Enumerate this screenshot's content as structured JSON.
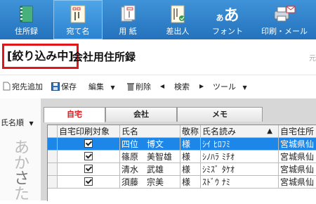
{
  "ribbon": {
    "tabs": [
      {
        "label": "住所録",
        "icon": "address-book-icon",
        "active": false
      },
      {
        "label": "宛て名",
        "icon": "address-card-icon",
        "active": true
      },
      {
        "label": "用 紙",
        "icon": "paper-icon",
        "active": false
      },
      {
        "label": "差出人",
        "icon": "sender-icon",
        "active": false
      },
      {
        "label": "フォント",
        "icon": "font-icon",
        "active": false
      },
      {
        "label": "印刷・メール",
        "icon": "printer-mail-icon",
        "active": false
      }
    ],
    "font_glyph_small": "あ",
    "font_glyph_large": "あ"
  },
  "header": {
    "filter_badge": "[絞り込み中]",
    "title": "会社用住所録",
    "right_fragment": "元"
  },
  "toolbar": {
    "add_address": "宛先追加",
    "save": "保存",
    "edit": "編集",
    "delete": "削除",
    "search": "検索",
    "tools": "ツール"
  },
  "left_panel": {
    "sort_label": "氏名順",
    "kana": [
      "あ",
      "か",
      "さ",
      "た"
    ]
  },
  "tabs": [
    {
      "label": "自宅",
      "active": true
    },
    {
      "label": "会社",
      "active": false
    },
    {
      "label": "メモ",
      "active": false
    }
  ],
  "table": {
    "columns": [
      "自宅印刷対象",
      "氏名",
      "敬称",
      "氏名読み",
      "自宅住所"
    ],
    "sort_indicator": "▲",
    "rows": [
      {
        "name": "四位　博文",
        "honorific": "様",
        "reading": "ｼｲ ﾋﾛﾌﾐ",
        "address": "宮城県仙",
        "selected": true,
        "checked": true
      },
      {
        "name": "篠原　美智雄",
        "honorific": "様",
        "reading": "ｼﾉﾊﾗ ﾐﾁｵ",
        "address": "宮城県仙",
        "selected": false,
        "checked": true
      },
      {
        "name": "清水　武雄",
        "honorific": "様",
        "reading": "ｼﾐｽﾞ ﾀｹｵ",
        "address": "宮城県仙",
        "selected": false,
        "checked": true
      },
      {
        "name": "須藤　宗美",
        "honorific": "様",
        "reading": "ｽﾄﾞｳ ﾅﾐ",
        "address": "宮城県仙",
        "selected": false,
        "checked": true
      }
    ]
  },
  "colors": {
    "ribbon": "#2a7dc9",
    "selection": "#1d86e9",
    "filter_border": "#e0161b",
    "active_tab_text": "#e0161b"
  }
}
